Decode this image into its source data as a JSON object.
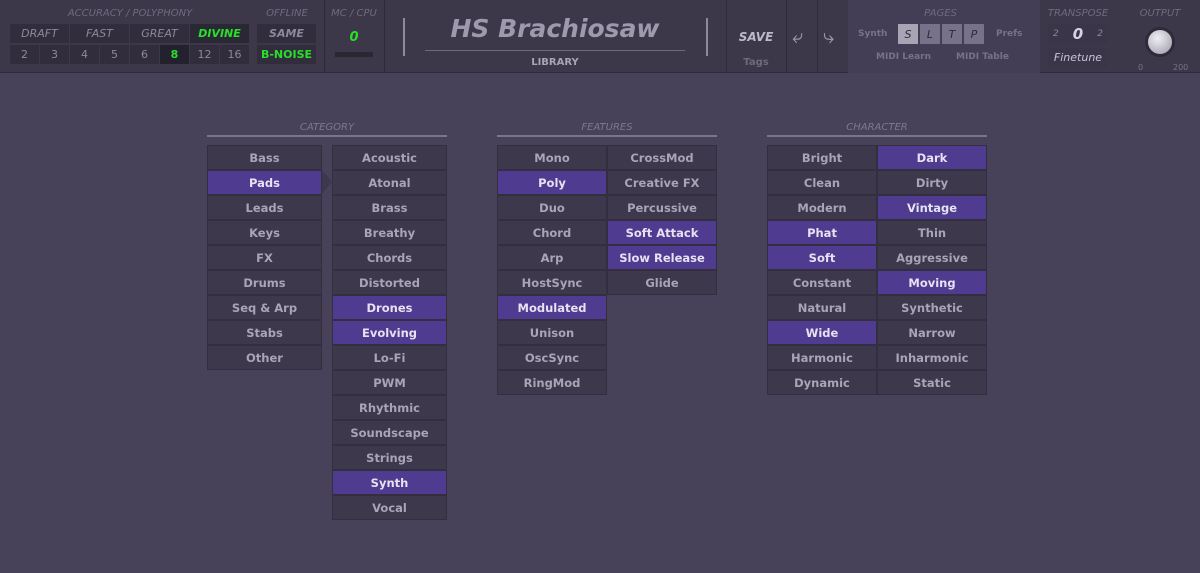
{
  "header": {
    "accuracy_label": "ACCURACY / POLYPHONY",
    "accuracy": [
      {
        "label": "DRAFT",
        "active": false
      },
      {
        "label": "FAST",
        "active": false
      },
      {
        "label": "GREAT",
        "active": false
      },
      {
        "label": "DIVINE",
        "active": true
      }
    ],
    "polyphony": [
      {
        "label": "2",
        "active": false
      },
      {
        "label": "3",
        "active": false
      },
      {
        "label": "4",
        "active": false
      },
      {
        "label": "5",
        "active": false
      },
      {
        "label": "6",
        "active": false
      },
      {
        "label": "8",
        "active": true
      },
      {
        "label": "12",
        "active": false
      },
      {
        "label": "16",
        "active": false
      }
    ],
    "offline_label": "OFFLINE",
    "offline_same": "SAME",
    "offline_noise": "B-NOISE",
    "cpu_label": "MC / CPU",
    "cpu_value": "0",
    "preset_name": "HS Brachiosaw",
    "library_label": "LIBRARY",
    "save_label": "SAVE",
    "tags_label": "Tags",
    "pages_label": "PAGES",
    "synth_label": "Synth",
    "prefs_label": "Prefs",
    "pages": [
      "S",
      "L",
      "T",
      "P"
    ],
    "active_page": "S",
    "midi_learn": "MIDI Learn",
    "midi_table": "MIDI Table",
    "transpose_label": "TRANSPOSE",
    "transpose_left": "2",
    "transpose_value": "0",
    "transpose_right": "2",
    "finetune_label": "Finetune",
    "output_label": "OUTPUT",
    "output_min": "0",
    "output_max": "200"
  },
  "category": {
    "title": "CATEGORY",
    "main": [
      {
        "label": "Bass",
        "sel": false
      },
      {
        "label": "Pads",
        "sel": true
      },
      {
        "label": "Leads",
        "sel": false
      },
      {
        "label": "Keys",
        "sel": false
      },
      {
        "label": "FX",
        "sel": false
      },
      {
        "label": "Drums",
        "sel": false
      },
      {
        "label": "Seq & Arp",
        "sel": false
      },
      {
        "label": "Stabs",
        "sel": false
      },
      {
        "label": "Other",
        "sel": false
      }
    ],
    "sub": [
      {
        "label": "Acoustic",
        "sel": false
      },
      {
        "label": "Atonal",
        "sel": false
      },
      {
        "label": "Brass",
        "sel": false
      },
      {
        "label": "Breathy",
        "sel": false
      },
      {
        "label": "Chords",
        "sel": false
      },
      {
        "label": "Distorted",
        "sel": false
      },
      {
        "label": "Drones",
        "sel": true
      },
      {
        "label": "Evolving",
        "sel": true
      },
      {
        "label": "Lo-Fi",
        "sel": false
      },
      {
        "label": "PWM",
        "sel": false
      },
      {
        "label": "Rhythmic",
        "sel": false
      },
      {
        "label": "Soundscape",
        "sel": false
      },
      {
        "label": "Strings",
        "sel": false
      },
      {
        "label": "Synth",
        "sel": true
      },
      {
        "label": "Vocal",
        "sel": false
      }
    ]
  },
  "features": {
    "title": "FEATURES",
    "col1": [
      {
        "label": "Mono",
        "sel": false
      },
      {
        "label": "Poly",
        "sel": true
      },
      {
        "label": "Duo",
        "sel": false
      },
      {
        "label": "Chord",
        "sel": false
      },
      {
        "label": "Arp",
        "sel": false
      },
      {
        "label": "HostSync",
        "sel": false
      },
      {
        "label": "Modulated",
        "sel": true
      },
      {
        "label": "Unison",
        "sel": false
      },
      {
        "label": "OscSync",
        "sel": false
      },
      {
        "label": "RingMod",
        "sel": false
      }
    ],
    "col2": [
      {
        "label": "CrossMod",
        "sel": false
      },
      {
        "label": "Creative FX",
        "sel": false
      },
      {
        "label": "Percussive",
        "sel": false
      },
      {
        "label": "Soft Attack",
        "sel": true
      },
      {
        "label": "Slow Release",
        "sel": true
      },
      {
        "label": "Glide",
        "sel": false
      }
    ]
  },
  "character": {
    "title": "CHARACTER",
    "col1": [
      {
        "label": "Bright",
        "sel": false
      },
      {
        "label": "Clean",
        "sel": false
      },
      {
        "label": "Modern",
        "sel": false
      },
      {
        "label": "Phat",
        "sel": true
      },
      {
        "label": "Soft",
        "sel": true
      },
      {
        "label": "Constant",
        "sel": false
      },
      {
        "label": "Natural",
        "sel": false
      },
      {
        "label": "Wide",
        "sel": true
      },
      {
        "label": "Harmonic",
        "sel": false
      },
      {
        "label": "Dynamic",
        "sel": false
      }
    ],
    "col2": [
      {
        "label": "Dark",
        "sel": true
      },
      {
        "label": "Dirty",
        "sel": false
      },
      {
        "label": "Vintage",
        "sel": true
      },
      {
        "label": "Thin",
        "sel": false
      },
      {
        "label": "Aggressive",
        "sel": false
      },
      {
        "label": "Moving",
        "sel": true
      },
      {
        "label": "Synthetic",
        "sel": false
      },
      {
        "label": "Narrow",
        "sel": false
      },
      {
        "label": "Inharmonic",
        "sel": false
      },
      {
        "label": "Static",
        "sel": false
      }
    ]
  }
}
